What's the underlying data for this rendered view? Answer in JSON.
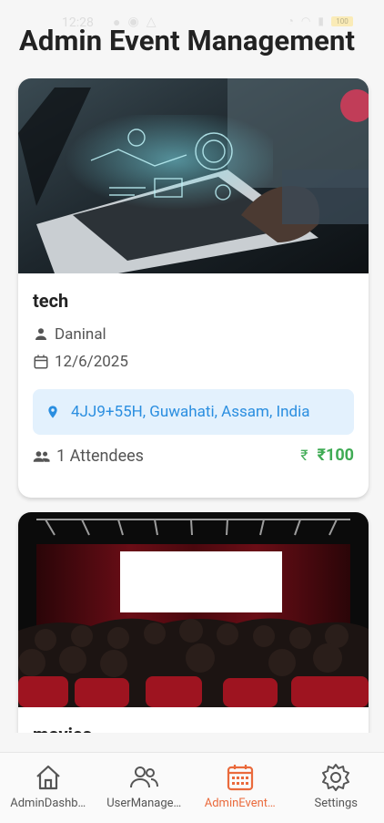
{
  "status_bar": {
    "time": "12:28",
    "battery": "100"
  },
  "page": {
    "title": "Admin Event Management"
  },
  "events": [
    {
      "title": "tech",
      "organizer": "Daninal",
      "date": "12/6/2025",
      "location": "4JJ9+55H, Guwahati, Assam, India",
      "attendees": "1 Attendees",
      "price": "₹100",
      "image": "laptop-holographic-ui-photo"
    },
    {
      "title": "movies",
      "image": "cinema-audience-photo"
    }
  ],
  "bottom_nav": {
    "items": [
      {
        "label": "AdminDashb…",
        "icon": "home-icon"
      },
      {
        "label": "UserManage…",
        "icon": "users-icon"
      },
      {
        "label": "AdminEvent…",
        "icon": "calendar-icon",
        "active": true
      },
      {
        "label": "Settings",
        "icon": "gear-icon"
      }
    ]
  },
  "colors": {
    "accent": "#ea6a3c",
    "price": "#3fab54",
    "location_text": "#2a8ee0",
    "location_bg": "#e3f1fd"
  }
}
